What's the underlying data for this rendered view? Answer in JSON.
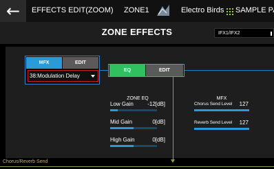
{
  "topbar": {
    "back_glyph": "←",
    "screen_title": "EFFECTS EDIT(ZOOM)",
    "zone": "ZONE1",
    "tone_name": "Electro Birds",
    "right_label": "SAMPLE PA"
  },
  "subbar": {
    "title": "ZONE EFFECTS",
    "ifx_select": "IFX1/IFX2"
  },
  "mfx": {
    "mfx_button": "MFX",
    "edit_button": "EDIT",
    "type_value": "38:Modulation Delay"
  },
  "eq_block": {
    "eq_button": "EQ",
    "edit_button": "EDIT"
  },
  "zone_eq": {
    "heading": "ZONE EQ",
    "params": [
      {
        "label": "Low Gain",
        "value": "-12[dB]",
        "level": 0.16
      },
      {
        "label": "Mid Gain",
        "value": "0[dB]",
        "level": 0.5
      },
      {
        "label": "High Gain",
        "value": "0[dB]",
        "level": 0.5
      }
    ]
  },
  "mfx_sends": {
    "heading": "MFX",
    "params": [
      {
        "label": "Chorus Send Level",
        "value": "127",
        "level": 1.0
      },
      {
        "label": "Reverb Send Level",
        "value": "127",
        "level": 1.0
      }
    ]
  },
  "bottom_label": "Chorus/Reverb Send",
  "colors": {
    "accent_blue": "#2a9ad8",
    "eq_green": "#30c060",
    "select_red": "#c82020",
    "line_olive": "#8ba14b"
  }
}
